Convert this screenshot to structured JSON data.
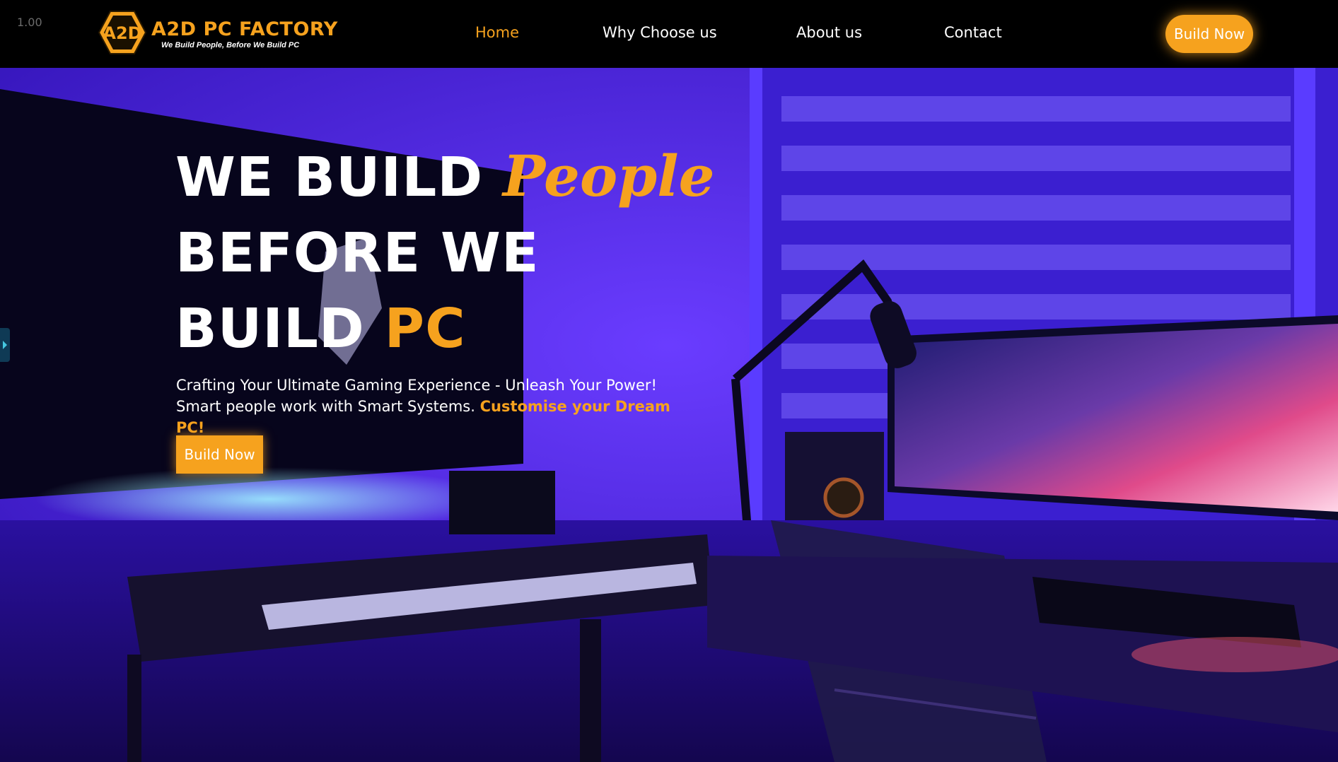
{
  "zoom_readout": "1.00",
  "brand": {
    "badge_text": "A2D",
    "name": "A2D PC FACTORY",
    "tagline": "We Build People, Before We Build PC"
  },
  "nav": {
    "items": [
      {
        "label": "Home",
        "active": true
      },
      {
        "label": "Why Choose us",
        "active": false
      },
      {
        "label": "About us",
        "active": false
      },
      {
        "label": "Contact",
        "active": false
      }
    ],
    "cta_label": "Build Now"
  },
  "hero": {
    "title_line1_main": "WE BUILD",
    "title_line1_accent": "People",
    "title_line2": "BEFORE WE",
    "title_line3_main": "BUILD",
    "title_line3_accent": "PC",
    "description": "Crafting Your Ultimate Gaming Experience - Unleash Your Power! Smart people work with Smart Systems.",
    "description_highlight": "Customise your Dream PC!",
    "cta_label": "Build Now"
  },
  "colors": {
    "accent": "#f6a21e",
    "header_bg": "#000000",
    "hero_purple": "#4c1fe0"
  }
}
